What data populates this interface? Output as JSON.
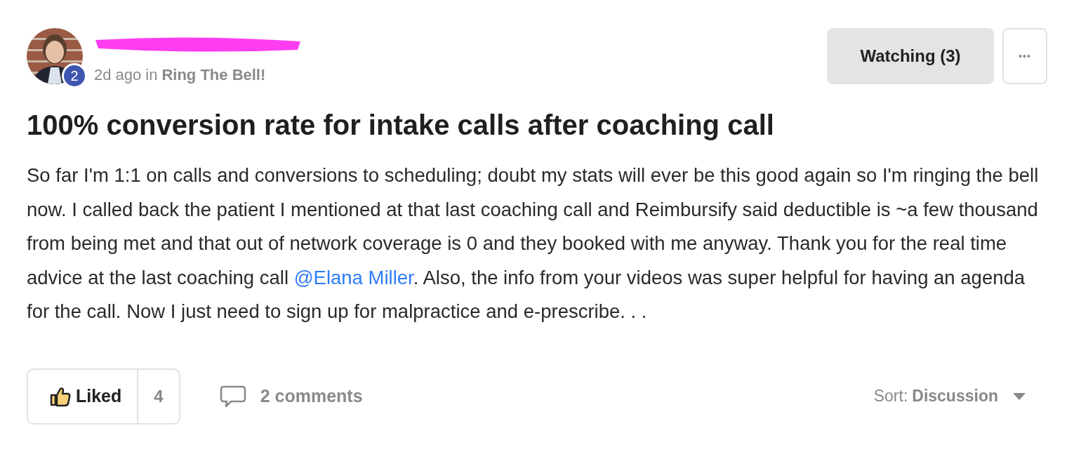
{
  "author": {
    "redacted": true,
    "level_badge": "2",
    "time": "2d ago",
    "in_word": "in",
    "group": "Ring The Bell!"
  },
  "watch_button": {
    "label": "Watching (3)",
    "on": true
  },
  "more_button": {
    "label": "•••"
  },
  "title": "100% conversion rate for intake calls after coaching call",
  "body": [
    {
      "kind": "text",
      "text": "So far I'm 1:1 on calls and conversions to scheduling; doubt my stats will ever be this good again so I'm ringing the bell now. I called back the patient I mentioned at that last coaching call and Reimbursify said deductible is ~a few thousand from being met and that out of network coverage is 0 and they booked with me anyway. Thank you for the real time advice at the last coaching call "
    },
    {
      "kind": "mention",
      "text": "@Elana Miller"
    },
    {
      "kind": "text",
      "text": ". Also, the info from your videos was super helpful for having an agenda for the call. Now I just need to sign up for malpractice and e-prescribe. . ."
    }
  ],
  "like_button": {
    "label": "Liked",
    "liked": true,
    "count": "4"
  },
  "comments": {
    "label": "2 comments"
  },
  "sort": {
    "label": "Sort:",
    "value": "Discussion"
  }
}
